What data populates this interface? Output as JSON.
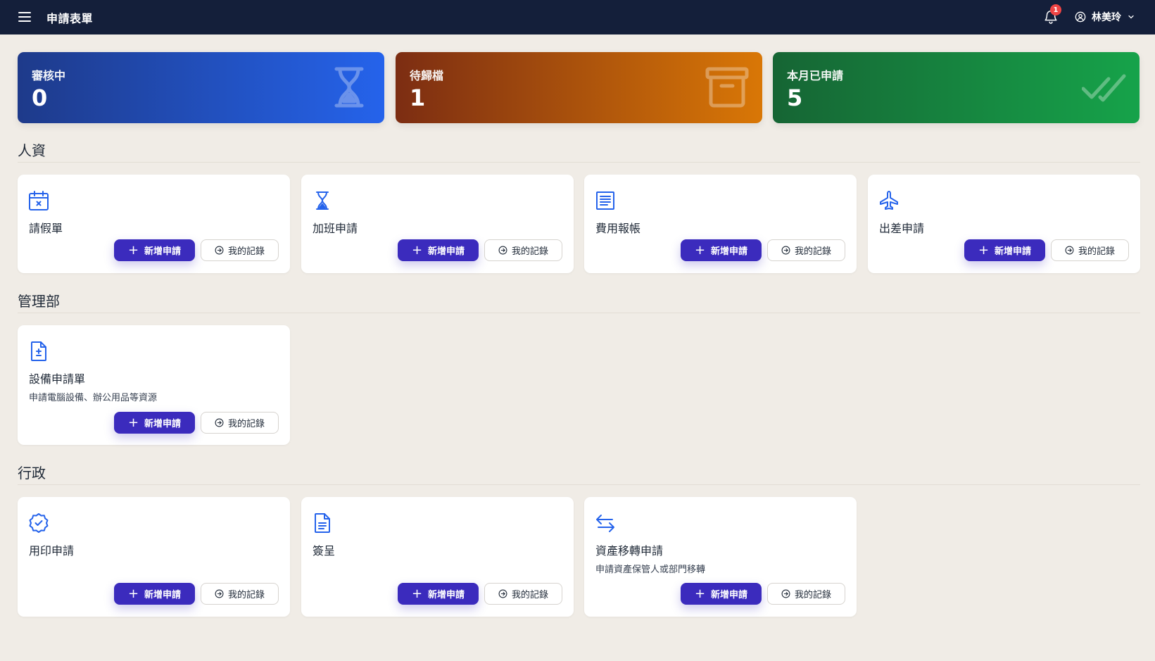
{
  "header": {
    "title": "申請表單",
    "notification_count": "1",
    "user_name": "林美玲"
  },
  "stats": [
    {
      "label": "審核中",
      "value": "0",
      "icon": "hourglass-icon"
    },
    {
      "label": "待歸檔",
      "value": "1",
      "icon": "archive-icon"
    },
    {
      "label": "本月已申請",
      "value": "5",
      "icon": "double-check-icon"
    }
  ],
  "buttons": {
    "new": "新增申請",
    "records": "我的記錄"
  },
  "sections": [
    {
      "title": "人資",
      "cards": [
        {
          "title": "請假單",
          "icon": "calendar-x-icon"
        },
        {
          "title": "加班申請",
          "icon": "hourglass-icon"
        },
        {
          "title": "費用報帳",
          "icon": "receipt-icon"
        },
        {
          "title": "出差申請",
          "icon": "airplane-icon"
        }
      ]
    },
    {
      "title": "管理部",
      "cards": [
        {
          "title": "設備申請單",
          "desc": "申請電腦設備、辦公用品等資源",
          "icon": "document-plus-minus-icon"
        }
      ]
    },
    {
      "title": "行政",
      "cards": [
        {
          "title": "用印申請",
          "icon": "badge-check-icon"
        },
        {
          "title": "簽呈",
          "icon": "document-text-icon"
        },
        {
          "title": "資產移轉申請",
          "desc": "申請資產保管人或部門移轉",
          "icon": "arrows-transfer-icon"
        }
      ]
    }
  ],
  "colors": {
    "topbar": "#141f3a",
    "primary_button": "#3b2bbd",
    "icon_blue": "#2563eb",
    "background": "#f0ece6"
  }
}
